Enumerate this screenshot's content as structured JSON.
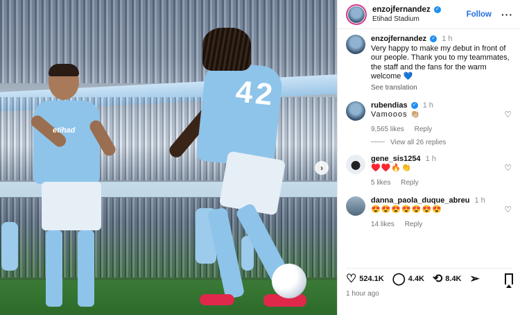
{
  "post": {
    "header": {
      "username": "enzojfernandez",
      "location": "Etihad Stadium",
      "follow_label": "Follow",
      "more_label": "···"
    },
    "photo": {
      "shirt_text": "etihad",
      "shirt_number": "42",
      "next_label": "›"
    },
    "caption": {
      "username": "enzojfernandez",
      "time": "1 h",
      "text": "Very happy to make my debut in front of our people. Thank you to my teammates, the staff and the fans for the warm welcome 💙",
      "see_translation": "See translation"
    },
    "comments": [
      {
        "username": "rubendias",
        "time": "1 h",
        "text": "Vamooos 👏🏼",
        "likes": "9,565 likes",
        "reply": "Reply"
      },
      {
        "username": "gene_sis1254",
        "time": "1 h",
        "text": "♥️♥️🔥👏",
        "likes": "5 likes",
        "reply": "Reply"
      },
      {
        "username": "danna_paola_duque_abreu",
        "time": "1 h",
        "text": "😍😍😍😍😍😍😍",
        "likes": "14 likes",
        "reply": "Reply"
      }
    ],
    "view_all_replies": "View all 26 replies",
    "actions": {
      "likes": "524.1K",
      "comments": "4.4K",
      "reposts": "8.4K"
    },
    "posted_ago": "1 hour ago"
  },
  "colors": {
    "accent": "#1f6fe0",
    "verified": "#1f8ef1",
    "kit": "#8ec4ea"
  },
  "icons": {
    "like": "heart-icon",
    "comment": "comment-bubble-icon",
    "repost": "repost-icon",
    "share": "send-icon",
    "save": "bookmark-icon"
  }
}
